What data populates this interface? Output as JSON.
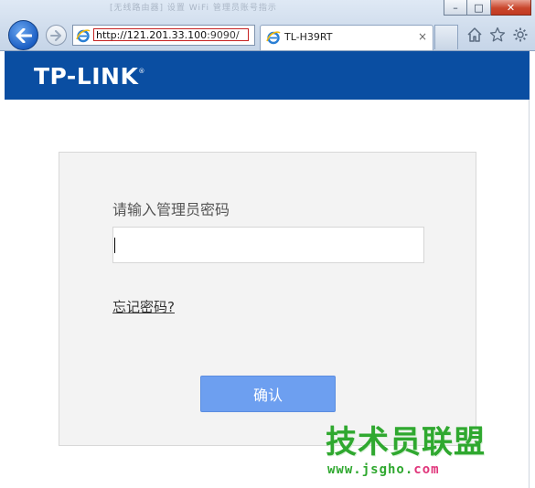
{
  "window": {
    "title": "[无线路由器] 设置 WiFi 管理员账号指示",
    "minimize_glyph": "–",
    "maximize_glyph": "□",
    "close_glyph": "✕"
  },
  "browser": {
    "url_host": "http://121.201.33.100",
    "url_port": ":9090/",
    "tab_title": "TL-H39RT",
    "tab_close_glyph": "×"
  },
  "icons": {
    "back": "back-arrow-icon",
    "forward": "forward-arrow-icon",
    "home": "home-icon",
    "favorites": "star-icon",
    "tools": "gear-icon",
    "ie": "ie-logo-icon"
  },
  "colors": {
    "header": "#0a4ea2",
    "button": "#6d9ff0",
    "card": "#f3f3f3",
    "watermark": "#2fa82f"
  },
  "page": {
    "brand": "TP-LINK",
    "brand_mark": "®",
    "prompt": "请输入管理员密码",
    "password_value": "",
    "forgot_link": "忘记密码?",
    "confirm_button": "确认"
  },
  "watermark": {
    "text": "技术员联盟",
    "url_main": "www.jsgho.",
    "url_tld": "com"
  }
}
